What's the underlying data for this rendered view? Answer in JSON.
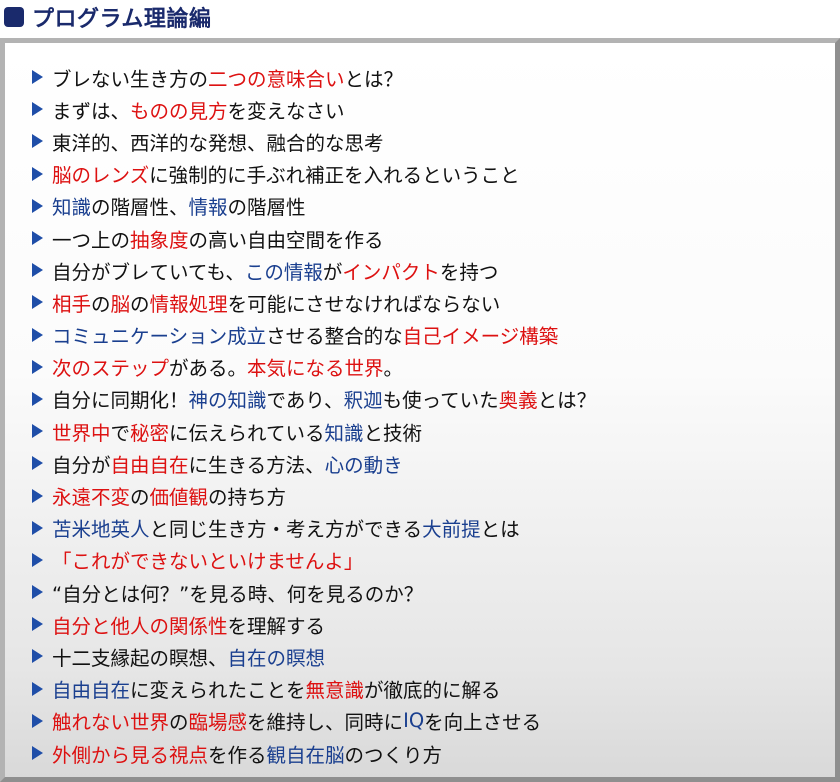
{
  "header": {
    "title": "プログラム理論編"
  },
  "items": [
    [
      [
        "ブレない生き方の",
        "n"
      ],
      [
        "二つの意味合い",
        "r"
      ],
      [
        "とは？",
        "n"
      ]
    ],
    [
      [
        "まずは、",
        "n"
      ],
      [
        "ものの見方",
        "r"
      ],
      [
        "を変えなさい",
        "n"
      ]
    ],
    [
      [
        "東洋的、西洋的な発想、融合的な思考",
        "n"
      ]
    ],
    [
      [
        "脳のレンズ",
        "r"
      ],
      [
        "に強制的に手ぶれ補正を入れるということ",
        "n"
      ]
    ],
    [
      [
        "知識",
        "b"
      ],
      [
        "の階層性、",
        "n"
      ],
      [
        "情報",
        "b"
      ],
      [
        "の階層性",
        "n"
      ]
    ],
    [
      [
        "一つ上の",
        "n"
      ],
      [
        "抽象度",
        "r"
      ],
      [
        "の高い自由空間を作る",
        "n"
      ]
    ],
    [
      [
        "自分がブレていても、",
        "n"
      ],
      [
        "この情報",
        "b"
      ],
      [
        "が",
        "n"
      ],
      [
        "インパクト",
        "r"
      ],
      [
        "を持つ",
        "n"
      ]
    ],
    [
      [
        "相手",
        "r"
      ],
      [
        "の",
        "n"
      ],
      [
        "脳",
        "r"
      ],
      [
        "の",
        "n"
      ],
      [
        "情報処理",
        "r"
      ],
      [
        "を可能にさせなければならない",
        "n"
      ]
    ],
    [
      [
        "コミュニケーション成立",
        "b"
      ],
      [
        "させる整合的な",
        "n"
      ],
      [
        "自己イメージ構築",
        "r"
      ]
    ],
    [
      [
        "次のステップ",
        "r"
      ],
      [
        "がある。",
        "n"
      ],
      [
        "本気になる世界",
        "r"
      ],
      [
        "。",
        "n"
      ]
    ],
    [
      [
        "自分に同期化！",
        "n"
      ],
      [
        "神の知識",
        "b"
      ],
      [
        "であり、",
        "n"
      ],
      [
        "釈迦",
        "b"
      ],
      [
        "も使っていた",
        "n"
      ],
      [
        "奥義",
        "r"
      ],
      [
        "とは？",
        "n"
      ]
    ],
    [
      [
        "世界中",
        "r"
      ],
      [
        "で",
        "n"
      ],
      [
        "秘密",
        "r"
      ],
      [
        "に伝えられている",
        "n"
      ],
      [
        "知識",
        "b"
      ],
      [
        "と技術",
        "n"
      ]
    ],
    [
      [
        "自分が",
        "n"
      ],
      [
        "自由自在",
        "r"
      ],
      [
        "に生きる方法、",
        "n"
      ],
      [
        "心の動き",
        "b"
      ]
    ],
    [
      [
        "永遠不変",
        "r"
      ],
      [
        "の",
        "n"
      ],
      [
        "価値観",
        "r"
      ],
      [
        "の持ち方",
        "n"
      ]
    ],
    [
      [
        "苫米地英人",
        "b"
      ],
      [
        "と同じ生き方・考え方ができる",
        "n"
      ],
      [
        "大前提",
        "b"
      ],
      [
        "とは",
        "n"
      ]
    ],
    [
      [
        "「これができないといけませんよ」",
        "r"
      ]
    ],
    [
      [
        "“自分とは何？”を見る時、何を見るのか？",
        "n"
      ]
    ],
    [
      [
        "自分と他人の関係性",
        "r"
      ],
      [
        "を理解する",
        "n"
      ]
    ],
    [
      [
        "十二支縁起の瞑想、",
        "n"
      ],
      [
        "自在の瞑想",
        "b"
      ]
    ],
    [
      [
        "自由自在",
        "b"
      ],
      [
        "に変えられたことを",
        "n"
      ],
      [
        "無意識",
        "r"
      ],
      [
        "が徹底的に解る",
        "n"
      ]
    ],
    [
      [
        "触れない世界",
        "r"
      ],
      [
        "の",
        "n"
      ],
      [
        "臨場感",
        "r"
      ],
      [
        "を維持し、同時に",
        "n"
      ],
      [
        "IQ",
        "b"
      ],
      [
        "を向上させる",
        "n"
      ]
    ],
    [
      [
        "外側から見る視点",
        "r"
      ],
      [
        "を作る",
        "n"
      ],
      [
        "観自在脳",
        "b"
      ],
      [
        "のつくり方",
        "n"
      ]
    ]
  ]
}
